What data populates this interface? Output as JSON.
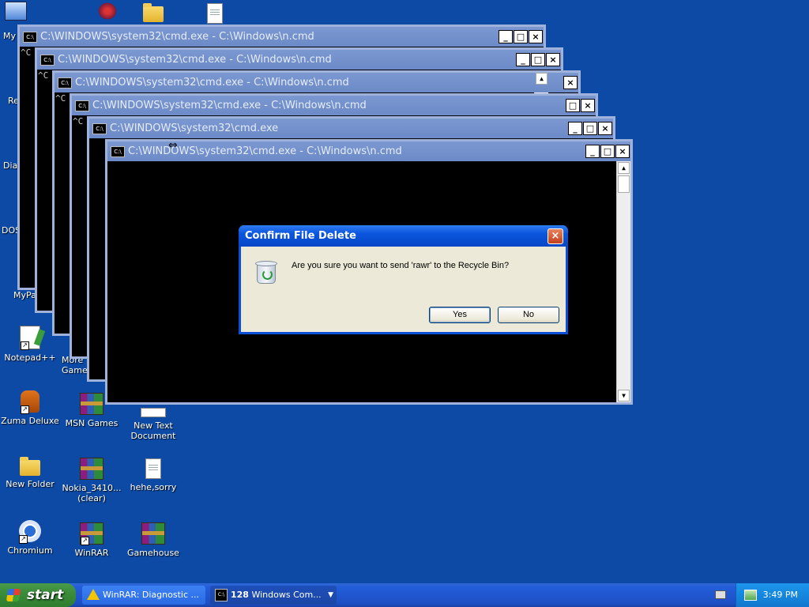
{
  "desktop": {
    "icons": [
      {
        "label": "Notepad++"
      },
      {
        "label": "Zuma Deluxe"
      },
      {
        "label": "MSN Games"
      },
      {
        "label": "New Text Document"
      },
      {
        "label": "New Folder"
      },
      {
        "label": "Nokia_3410... (clear)"
      },
      {
        "label": "hehe,sorry"
      },
      {
        "label": "Chromium"
      },
      {
        "label": "WinRAR"
      },
      {
        "label": "Gamehouse"
      },
      {
        "label": "More Games"
      }
    ],
    "partial_labels": [
      "My",
      "Re",
      "Dia",
      "DOS",
      "MyPa"
    ]
  },
  "cmd_windows": [
    {
      "title": "C:\\WINDOWS\\system32\\cmd.exe - C:\\Windows\\n.cmd",
      "body": "^C"
    },
    {
      "title": "C:\\WINDOWS\\system32\\cmd.exe - C:\\Windows\\n.cmd",
      "body": "^C"
    },
    {
      "title": "C:\\WINDOWS\\system32\\cmd.exe - C:\\Windows\\n.cmd",
      "body": "^C"
    },
    {
      "title": "C:\\WINDOWS\\system32\\cmd.exe - C:\\Windows\\n.cmd",
      "body": "^C"
    },
    {
      "title": "C:\\WINDOWS\\system32\\cmd.exe",
      "body": ""
    },
    {
      "title": "C:\\WINDOWS\\system32\\cmd.exe - C:\\Windows\\n.cmd",
      "body": ""
    }
  ],
  "cmd_icon_text": "C:\\",
  "window_controls": {
    "minimize": "_",
    "maximize": "□",
    "close": "×"
  },
  "dialog": {
    "title": "Confirm File Delete",
    "message": "Are you sure you want to send 'rawr' to the Recycle Bin?",
    "yes_label": "Yes",
    "no_label": "No",
    "close_glyph": "×"
  },
  "taskbar": {
    "start_label": "start",
    "buttons": [
      {
        "label": "WinRAR: Diagnostic ...",
        "icon": "warning-icon"
      },
      {
        "count": "128",
        "label": "Windows Com...",
        "icon": "cmd-icon"
      }
    ],
    "clock": "3:49 PM"
  },
  "colors": {
    "desktop": "#0c4aa6",
    "dialog_title": "#0a55dd",
    "taskbar": "#245edb",
    "start": "#3a8c3a"
  }
}
